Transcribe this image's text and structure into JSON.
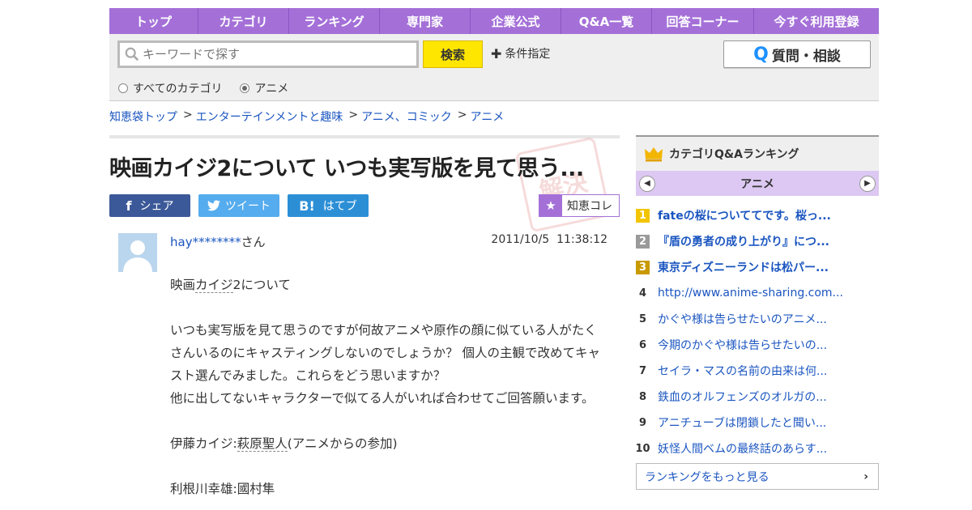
{
  "nav": {
    "items": [
      "トップ",
      "カテゴリ",
      "ランキング",
      "専門家",
      "企業公式",
      "Q&A一覧",
      "回答コーナー",
      "今すぐ利用登録"
    ]
  },
  "search": {
    "placeholder": "キーワードで探す",
    "button": "検索",
    "conditions": "条件指定",
    "ask_button": "質問・相談",
    "scope_all": "すべてのカテゴリ",
    "scope_current": "アニメ",
    "selected_scope": "アニメ"
  },
  "breadcrumb": [
    "知恵袋トップ",
    "エンターテインメントと趣味",
    "アニメ、コミック",
    "アニメ"
  ],
  "question": {
    "title": "映画カイジ2について いつも実写版を見て思う...",
    "share": {
      "facebook": "シェア",
      "twitter": "ツイート",
      "hatena": "はてブ"
    },
    "collect": "知恵コレ",
    "user_name": "hay********",
    "user_suffix": "さん",
    "date": "2011/10/5",
    "time": "11:38:12",
    "body_line1_a": "映画",
    "body_line1_kw": "カイジ",
    "body_line1_b": "2について",
    "body_para2": "いつも実写版を見て思うのですが何故アニメや原作の顔に似ている人がたくさんいるのにキャスティングしないのでしょうか？ 個人の主観で改めてキャスト選んでみました。これらをどう思いますか？",
    "body_para3": "他に出してないキャラクターで似てる人がいれば合わせてご回答願います。",
    "body_line4_a": "伊藤カイジ:",
    "body_line4_kw": "萩原聖人",
    "body_line4_b": "(アニメからの参加)",
    "body_line5": "利根川幸雄:國村隼"
  },
  "ranking": {
    "header": "カテゴリQ&Aランキング",
    "category": "アニメ",
    "items": [
      {
        "rank": "1",
        "text": "fateの桜についててです。桜っ..."
      },
      {
        "rank": "2",
        "text": "『盾の勇者の成り上がり』につ..."
      },
      {
        "rank": "3",
        "text": "東京ディズニーランドは松パー..."
      },
      {
        "rank": "4",
        "text": "http://www.anime-sharing.com..."
      },
      {
        "rank": "5",
        "text": "かぐや様は告らせたいのアニメ..."
      },
      {
        "rank": "6",
        "text": "今期のかぐや様は告らせたいの..."
      },
      {
        "rank": "7",
        "text": "セイラ・マスの名前の由来は何..."
      },
      {
        "rank": "8",
        "text": "鉄血のオルフェンズのオルガの..."
      },
      {
        "rank": "9",
        "text": "アニチューブは閉鎖したと聞い..."
      },
      {
        "rank": "10",
        "text": "妖怪人間ベムの最終話のあらす..."
      }
    ],
    "more": "ランキングをもっと見る"
  },
  "colors": {
    "nav_bg": "#a470d8",
    "link": "#1a55c0",
    "search_button": "#ffe600",
    "sidebar_sub": "#dcc8f2"
  },
  "icons": [
    "search-icon",
    "plus-icon",
    "question-icon",
    "facebook-icon",
    "twitter-icon",
    "hatena-icon",
    "star-icon",
    "crown-icon",
    "chevron-left-icon",
    "chevron-right-icon"
  ]
}
